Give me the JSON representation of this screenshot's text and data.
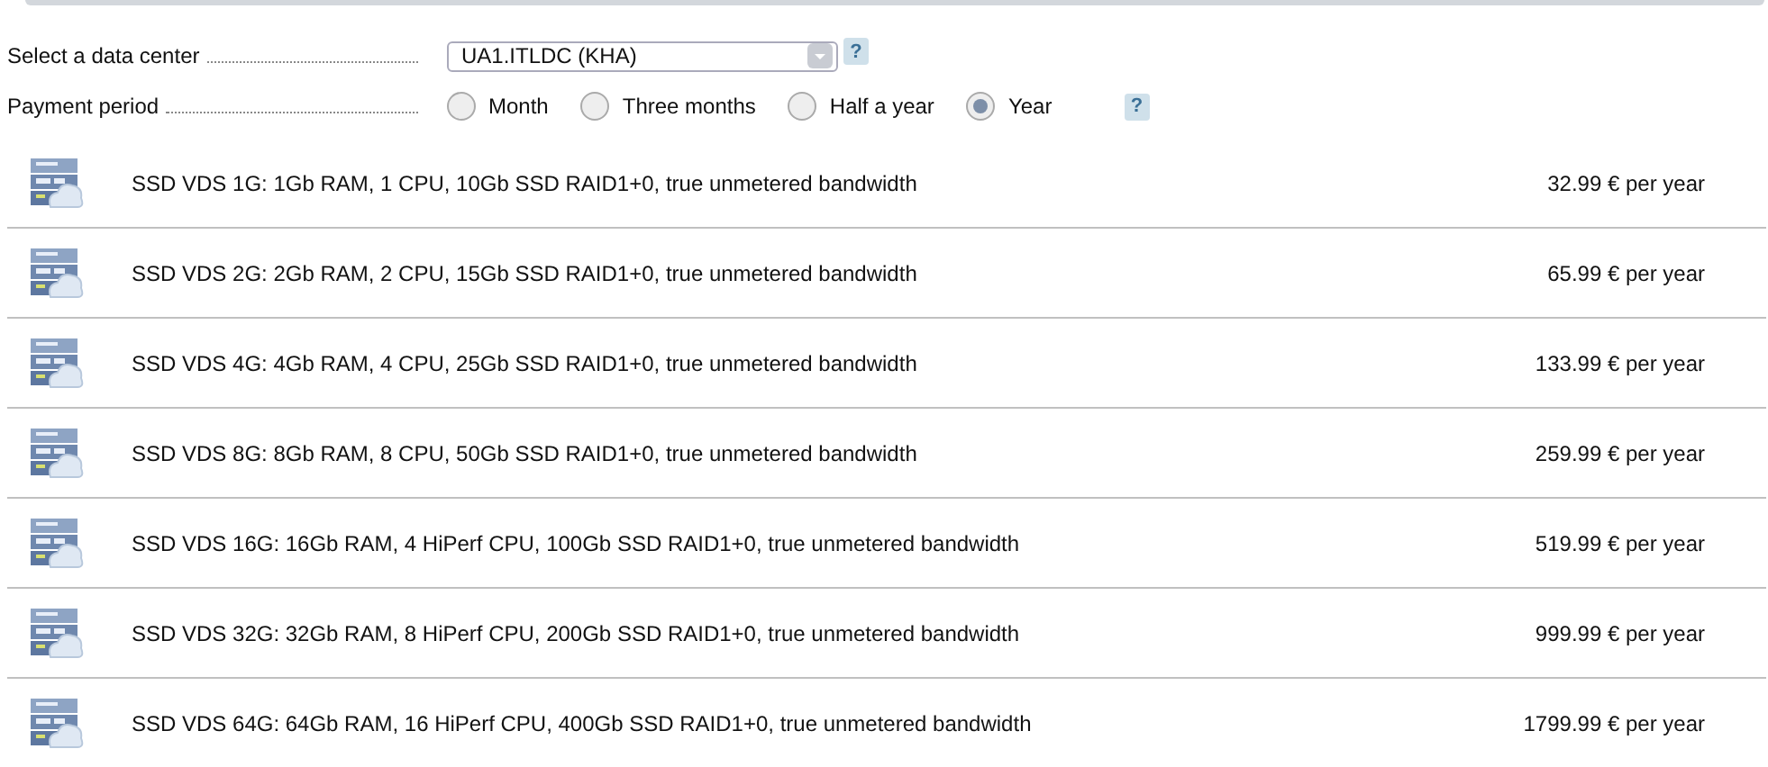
{
  "data_center": {
    "label": "Select a data center",
    "value": "UA1.ITLDC (KHA)",
    "help": "?"
  },
  "payment_period": {
    "label": "Payment period",
    "help": "?",
    "options": [
      {
        "label": "Month",
        "selected": false
      },
      {
        "label": "Three months",
        "selected": false
      },
      {
        "label": "Half a year",
        "selected": false
      },
      {
        "label": "Year",
        "selected": true
      }
    ]
  },
  "plans": [
    {
      "description": "SSD VDS 1G: 1Gb RAM, 1 CPU, 10Gb SSD RAID1+0, true unmetered bandwidth",
      "price": "32.99 € per year"
    },
    {
      "description": "SSD VDS 2G: 2Gb RAM, 2 CPU, 15Gb SSD RAID1+0, true unmetered bandwidth",
      "price": "65.99 € per year"
    },
    {
      "description": "SSD VDS 4G: 4Gb RAM, 4 CPU, 25Gb SSD RAID1+0, true unmetered bandwidth",
      "price": "133.99 € per year"
    },
    {
      "description": "SSD VDS 8G: 8Gb RAM, 8 CPU, 50Gb SSD RAID1+0, true unmetered bandwidth",
      "price": "259.99 € per year"
    },
    {
      "description": "SSD VDS 16G: 16Gb RAM, 4 HiPerf CPU, 100Gb SSD RAID1+0, true unmetered bandwidth",
      "price": "519.99 € per year"
    },
    {
      "description": "SSD VDS 32G: 32Gb RAM, 8 HiPerf CPU, 200Gb SSD RAID1+0, true unmetered bandwidth",
      "price": "999.99 € per year"
    },
    {
      "description": "SSD VDS 64G: 64Gb RAM, 16 HiPerf CPU, 400Gb SSD RAID1+0, true unmetered bandwidth",
      "price": "1799.99 € per year"
    }
  ]
}
